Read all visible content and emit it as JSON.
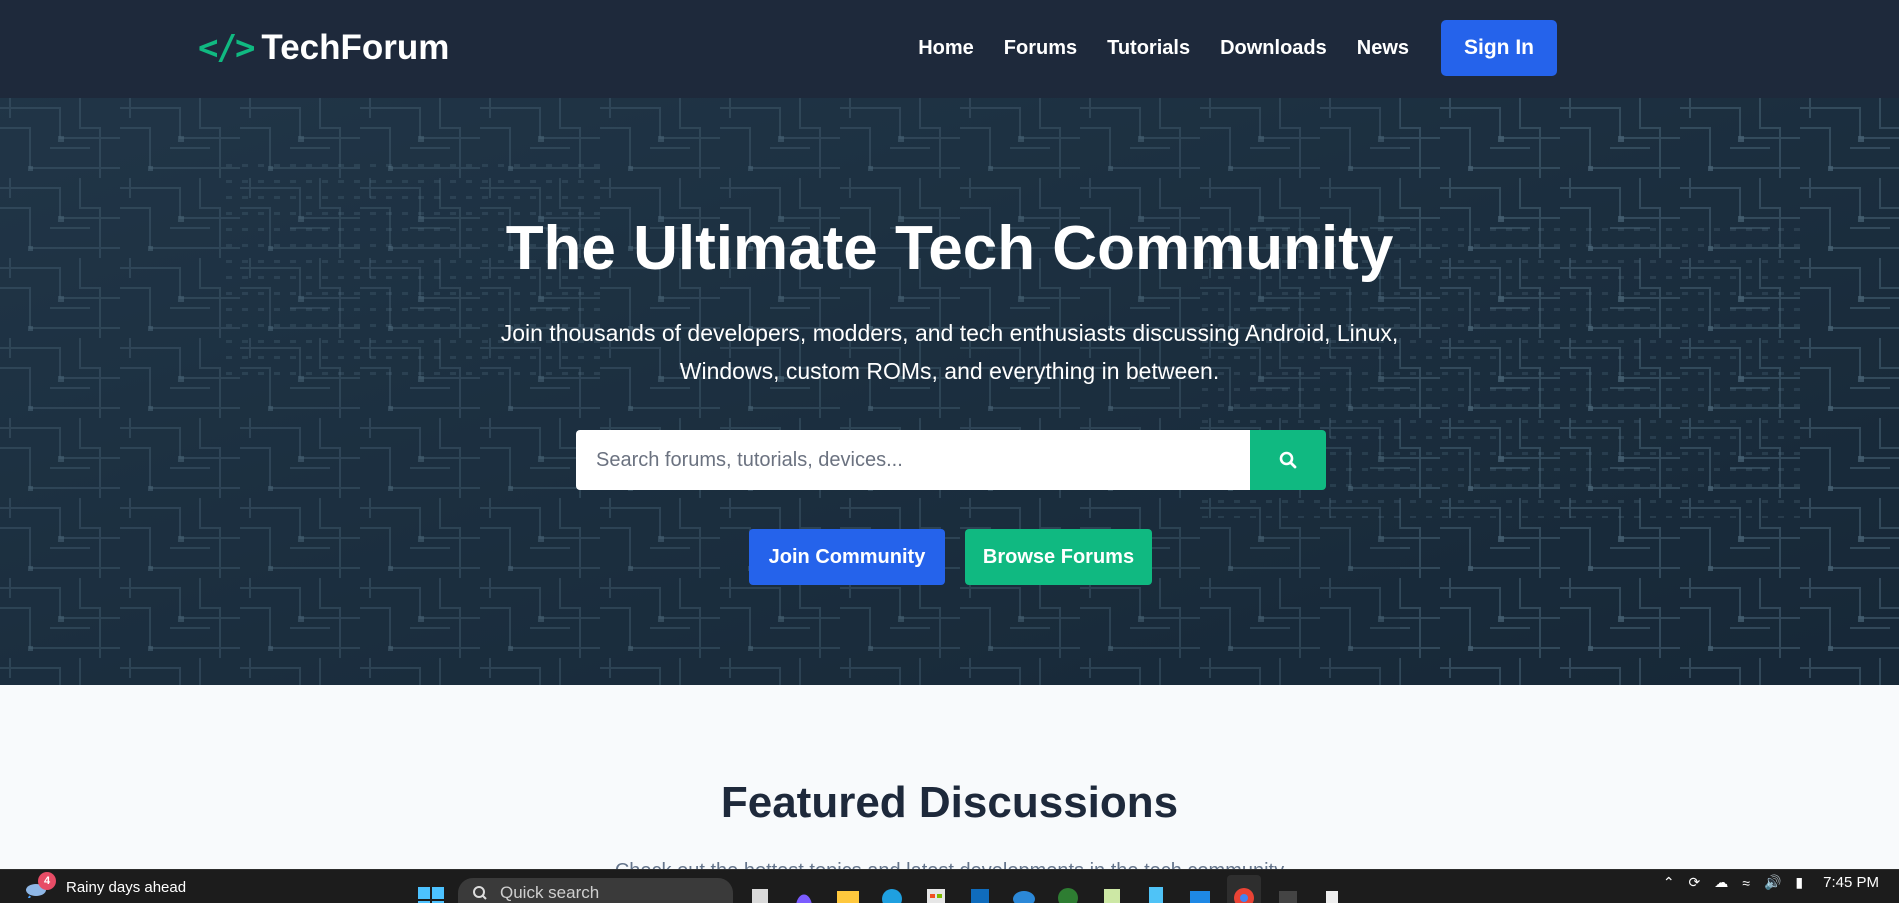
{
  "header": {
    "logo_symbol": "</>",
    "logo_text": "TechForum",
    "nav": [
      "Home",
      "Forums",
      "Tutorials",
      "Downloads",
      "News"
    ],
    "signin_label": "Sign In"
  },
  "hero": {
    "title": "The Ultimate Tech Community",
    "subtitle": "Join thousands of developers, modders, and tech enthusiasts discussing Android, Linux, Windows, custom ROMs, and everything in between.",
    "search_placeholder": "Search forums, tutorials, devices...",
    "join_label": "Join Community",
    "browse_label": "Browse Forums"
  },
  "featured": {
    "title": "Featured Discussions",
    "subtitle": "Check out the hottest topics and latest developments in the tech community"
  },
  "taskbar": {
    "weather_badge": "4",
    "weather_text": "Rainy days ahead",
    "search_label": "Quick search",
    "clock": "7:45 PM",
    "icons": [
      "start-icon",
      "search-icon",
      "file-icon",
      "copilot-icon",
      "folder-icon",
      "edge-icon",
      "store-icon",
      "outlook-icon",
      "cloud-app-icon",
      "hs-app-icon",
      "notepad-icon",
      "notes-icon",
      "photos-icon",
      "chrome-icon",
      "terminal-icon",
      "app-icon"
    ]
  },
  "colors": {
    "header_bg": "#1e293b",
    "primary": "#2563eb",
    "accent": "#10b981"
  }
}
